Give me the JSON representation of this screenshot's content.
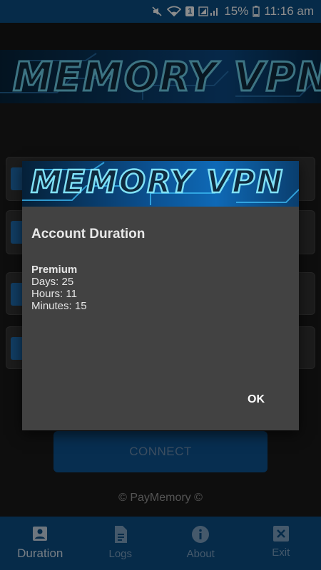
{
  "status_bar": {
    "badge": "1",
    "battery": "15%",
    "time": "11:16 am",
    "icons": [
      "mute-icon",
      "wifi-icon",
      "sim-icon",
      "signal-icon",
      "battery-icon"
    ]
  },
  "app": {
    "logo_text": "MEMORY VPN",
    "connect_label": "CONNECT",
    "copyright": "© PayMemory ©"
  },
  "bottom_nav": {
    "items": [
      {
        "label": "Duration",
        "icon": "account-box-icon",
        "active": true
      },
      {
        "label": "Logs",
        "icon": "document-icon",
        "active": false
      },
      {
        "label": "About",
        "icon": "info-icon",
        "active": false
      },
      {
        "label": "Exit",
        "icon": "close-box-icon",
        "active": false
      }
    ]
  },
  "dialog": {
    "banner_text": "MEMORY VPN",
    "title": "Account Duration",
    "plan": "Premium",
    "days": "Days: 25",
    "hours": "Hours: 11",
    "minutes": "Minutes: 15",
    "ok_label": "OK"
  },
  "colors": {
    "primary": "#0c4f86",
    "dialog_bg": "#424242",
    "background": "#1b1b1b"
  }
}
